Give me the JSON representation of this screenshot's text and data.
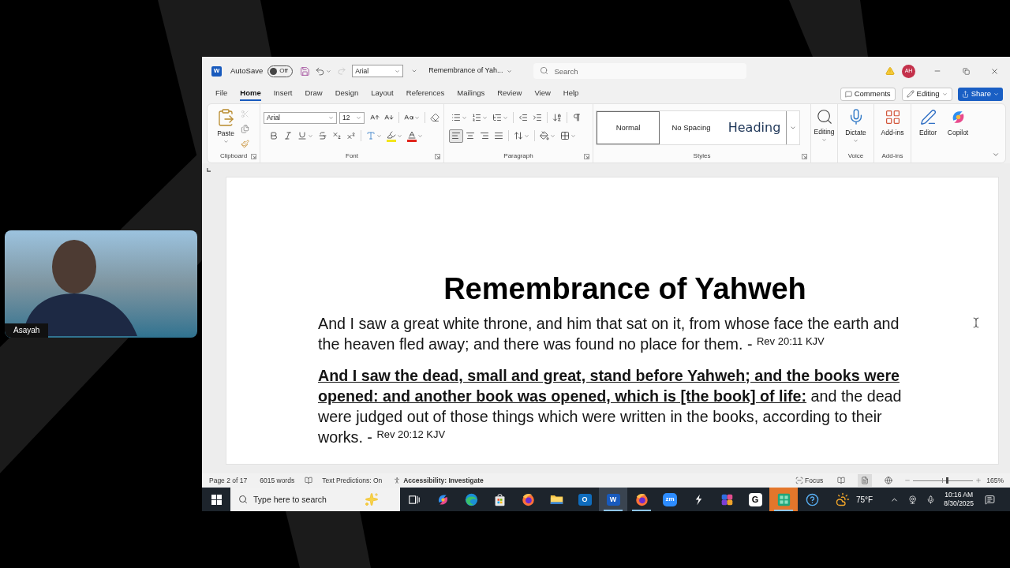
{
  "video_tile": {
    "name": "Asayah"
  },
  "title_bar": {
    "app_glyph": "W",
    "autosave_label": "AutoSave",
    "autosave": {
      "on": false,
      "label": "Off"
    },
    "redo": {
      "disabled": true
    },
    "font_box": "Arial",
    "document_name": "Remembrance of Yah...",
    "search": {
      "placeholder": "Search"
    },
    "account_initials": "AH"
  },
  "menu_tabs": [
    {
      "label": "File",
      "selected": false
    },
    {
      "label": "Home",
      "selected": true
    },
    {
      "label": "Insert",
      "selected": false
    },
    {
      "label": "Draw",
      "selected": false
    },
    {
      "label": "Design",
      "selected": false
    },
    {
      "label": "Layout",
      "selected": false
    },
    {
      "label": "References",
      "selected": false
    },
    {
      "label": "Mailings",
      "selected": false
    },
    {
      "label": "Review",
      "selected": false
    },
    {
      "label": "View",
      "selected": false
    },
    {
      "label": "Help",
      "selected": false
    }
  ],
  "action_buttons": [
    {
      "kind": "comments",
      "label": "Comments"
    },
    {
      "kind": "editing",
      "label": "Editing"
    },
    {
      "kind": "share",
      "label": "Share"
    }
  ],
  "ribbon": {
    "clipboard": {
      "paste": "Paste",
      "cut": {
        "disabled": true
      },
      "label": "Clipboard"
    },
    "font": {
      "name": "Arial",
      "size": "12",
      "label": "Font"
    },
    "paragraph": {
      "alignments": [
        {
          "kind": "left",
          "selected": true
        },
        {
          "kind": "center",
          "selected": false
        },
        {
          "kind": "right",
          "selected": false
        },
        {
          "kind": "justify",
          "selected": false
        }
      ],
      "label": "Paragraph"
    },
    "styles": {
      "items": [
        {
          "kind": "body",
          "label": "Normal",
          "selected": true
        },
        {
          "kind": "body",
          "label": "No Spacing",
          "selected": false
        },
        {
          "kind": "heading",
          "label": "Heading",
          "selected": false
        }
      ],
      "label": "Styles"
    },
    "editing": {
      "button": "Editing"
    },
    "voice": {
      "button": "Dictate",
      "label": "Voice"
    },
    "add_ins": {
      "button": "Add-ins",
      "label": "Add-ins"
    },
    "tools": [
      {
        "kind": "editor",
        "label": "Editor"
      },
      {
        "kind": "copilot",
        "label": "Copilot"
      }
    ]
  },
  "document": {
    "title": "Remembrance of Yahweh",
    "paragraphs": [
      "And I saw a great white throne, and him that sat on it, from whose face the earth and the heaven fled away; and there was found no place for them. - $^{Rev 20:11 KJV}$",
      "**And I saw the dead, small and great, stand before Yahweh; and the books were opened: and another book was opened, which is [the book] of life:** and the dead were judged out of those things which were written in the books, according to their works. - $^{Rev 20:12 KJV}$"
    ]
  },
  "status_bar": {
    "page": "Page 2 of 17",
    "words": "6015 words",
    "text_predictions": "Text Predictions: On",
    "accessibility": "Accessibility: Investigate",
    "focus": "Focus",
    "views": [
      {
        "kind": "read",
        "selected": false
      },
      {
        "kind": "print",
        "selected": true
      },
      {
        "kind": "web",
        "selected": false
      }
    ],
    "zoom": {
      "level": 0.56,
      "reading": "165%"
    }
  },
  "taskbar": {
    "search": {
      "placeholder": "Type here to search"
    },
    "apps": [
      {
        "kind": "task_view",
        "selected": false,
        "running": false,
        "alert": false
      },
      {
        "kind": "swirl",
        "selected": false,
        "running": false,
        "alert": false
      },
      {
        "kind": "round",
        "selected": false,
        "running": false,
        "alert": false
      },
      {
        "kind": "store",
        "selected": false,
        "running": false,
        "alert": false
      },
      {
        "kind": "fox",
        "selected": false,
        "running": false,
        "alert": false
      },
      {
        "kind": "folder",
        "selected": false,
        "running": false,
        "alert": false
      },
      {
        "kind": "mail",
        "glyph": "O",
        "selected": false,
        "running": false,
        "alert": false
      },
      {
        "kind": "document",
        "glyph": "W",
        "selected": true,
        "running": true,
        "alert": false
      },
      {
        "kind": "fox",
        "selected": false,
        "running": true,
        "alert": false
      },
      {
        "kind": "video",
        "glyph": "zm",
        "selected": false,
        "running": false,
        "alert": false
      },
      {
        "kind": "bolt",
        "selected": false,
        "running": false,
        "alert": false
      },
      {
        "kind": "tiles",
        "selected": false,
        "running": false,
        "alert": false
      },
      {
        "kind": "letter",
        "glyph": "G",
        "selected": false,
        "running": false,
        "alert": false
      },
      {
        "kind": "grid",
        "selected": false,
        "running": true,
        "alert": true
      },
      {
        "kind": "help",
        "selected": false,
        "running": false,
        "alert": false
      }
    ],
    "weather": "75°F",
    "time": "10:16 AM",
    "date": "8/30/2025"
  }
}
